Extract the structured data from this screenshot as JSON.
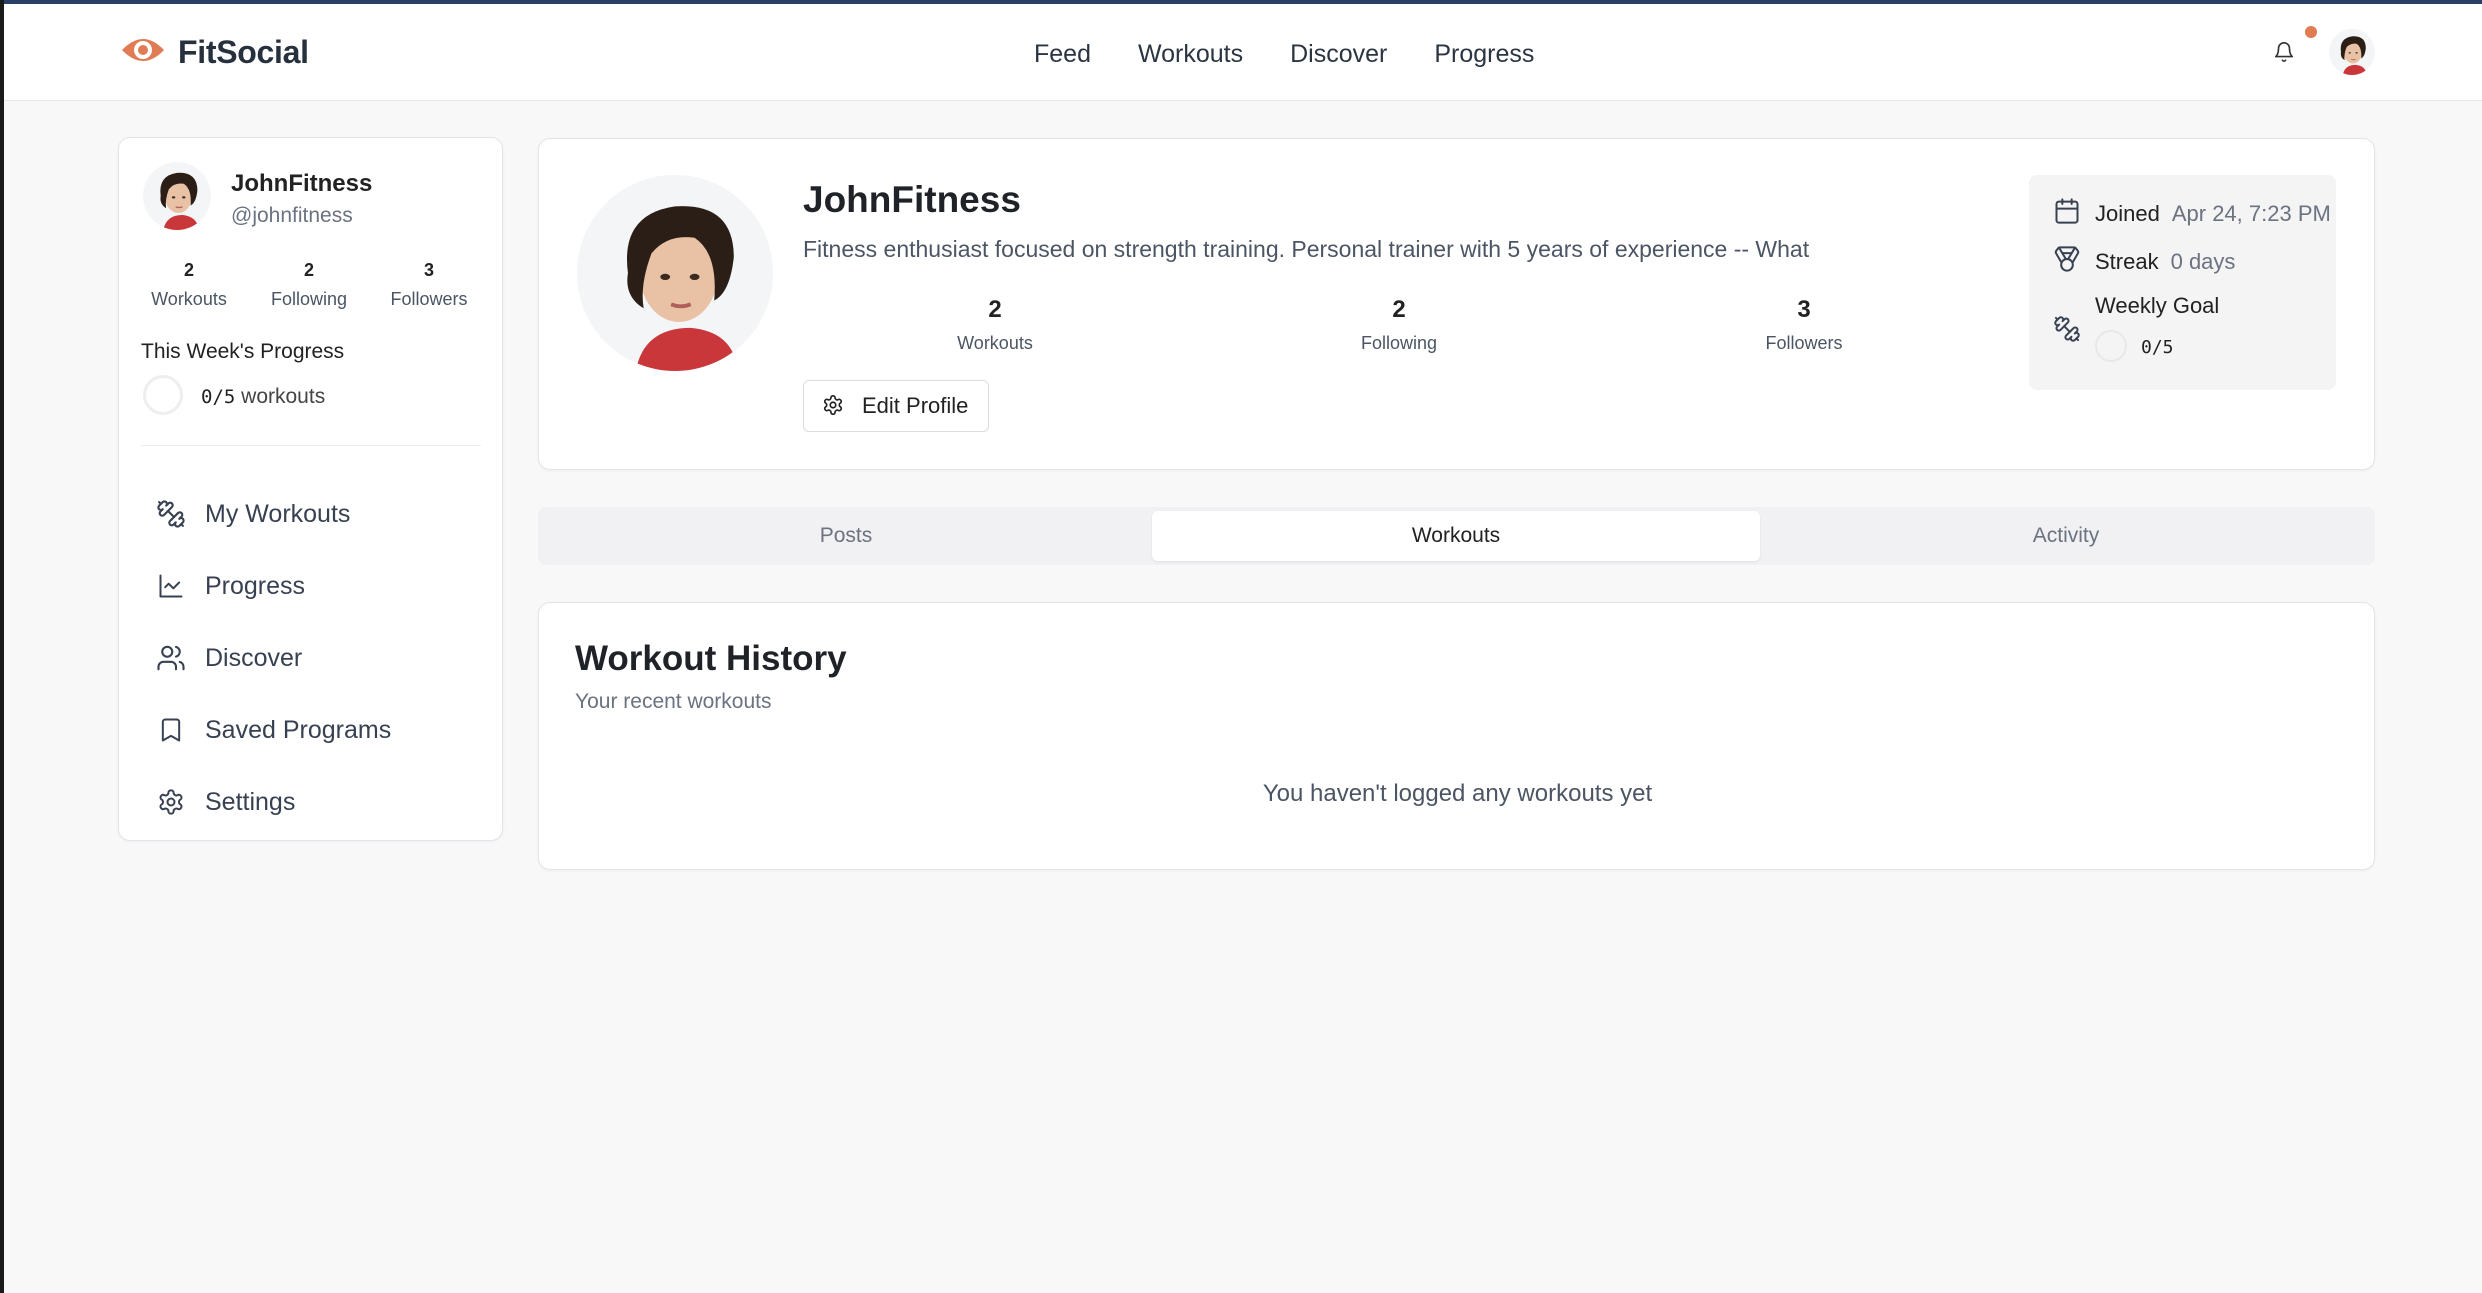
{
  "app": {
    "name": "FitSocial",
    "brand_color": "#e07b53"
  },
  "nav": {
    "links": [
      "Feed",
      "Workouts",
      "Discover",
      "Progress"
    ]
  },
  "sidebar": {
    "name": "JohnFitness",
    "handle": "@johnfitness",
    "stats": [
      {
        "value": "2",
        "label": "Workouts"
      },
      {
        "value": "2",
        "label": "Following"
      },
      {
        "value": "3",
        "label": "Followers"
      }
    ],
    "week_title": "This Week's Progress",
    "week_count": "0/5",
    "week_suffix": " workouts",
    "menu": [
      {
        "label": "My Workouts",
        "icon": "dumbbell-icon"
      },
      {
        "label": "Progress",
        "icon": "chart-line-icon"
      },
      {
        "label": "Discover",
        "icon": "users-icon"
      },
      {
        "label": "Saved Programs",
        "icon": "bookmark-icon"
      },
      {
        "label": "Settings",
        "icon": "gear-icon"
      }
    ]
  },
  "profile": {
    "name": "JohnFitness",
    "bio": "Fitness enthusiast focused on strength training. Personal trainer with 5 years of experience -- What",
    "stats": [
      {
        "value": "2",
        "label": "Workouts"
      },
      {
        "value": "2",
        "label": "Following"
      },
      {
        "value": "3",
        "label": "Followers"
      }
    ],
    "edit_label": "Edit Profile",
    "joined_label": "Joined",
    "joined_value": "Apr 24, 7:23 PM",
    "streak_label": "Streak",
    "streak_value": "0 days",
    "goal_label": "Weekly Goal",
    "goal_value": "0/5"
  },
  "tabs": [
    {
      "label": "Posts",
      "active": false
    },
    {
      "label": "Workouts",
      "active": true
    },
    {
      "label": "Activity",
      "active": false
    }
  ],
  "history": {
    "title": "Workout History",
    "subtitle": "Your recent workouts",
    "empty": "You haven't logged any workouts yet"
  }
}
